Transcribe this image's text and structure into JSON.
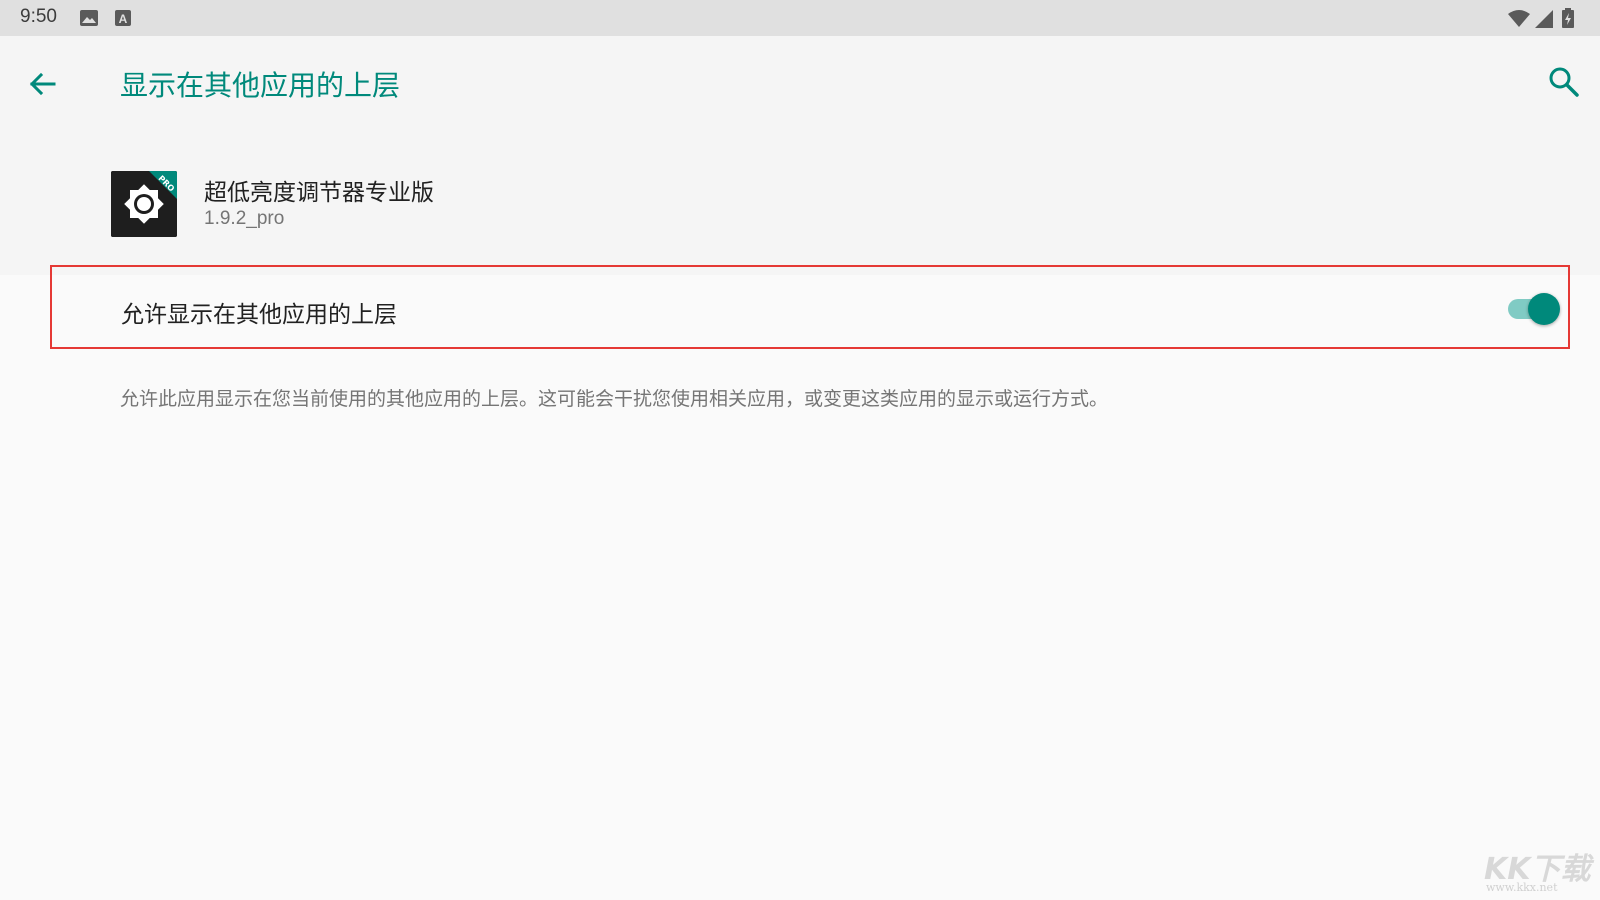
{
  "status_bar": {
    "time": "9:50"
  },
  "app_bar": {
    "title": "显示在其他应用的上层",
    "back_icon": "arrow-back-icon",
    "search_icon": "search-icon"
  },
  "app": {
    "name": "超低亮度调节器专业版",
    "version": "1.9.2_pro",
    "icon": "gear-sun-icon",
    "icon_badge": "PRO"
  },
  "permission": {
    "label": "允许显示在其他应用的上层",
    "enabled": true,
    "description": "允许此应用显示在您当前使用的其他应用的上层。这可能会干扰您使用相关应用，或变更这类应用的显示或运行方式。"
  },
  "watermark": {
    "brand": "KK下载",
    "url": "www.kkx.net"
  },
  "colors": {
    "accent": "#00897b",
    "highlight_border": "#e53935",
    "status_bar_bg": "#e0e0e0",
    "header_bg": "#f5f5f5",
    "page_bg": "#fafafa"
  }
}
